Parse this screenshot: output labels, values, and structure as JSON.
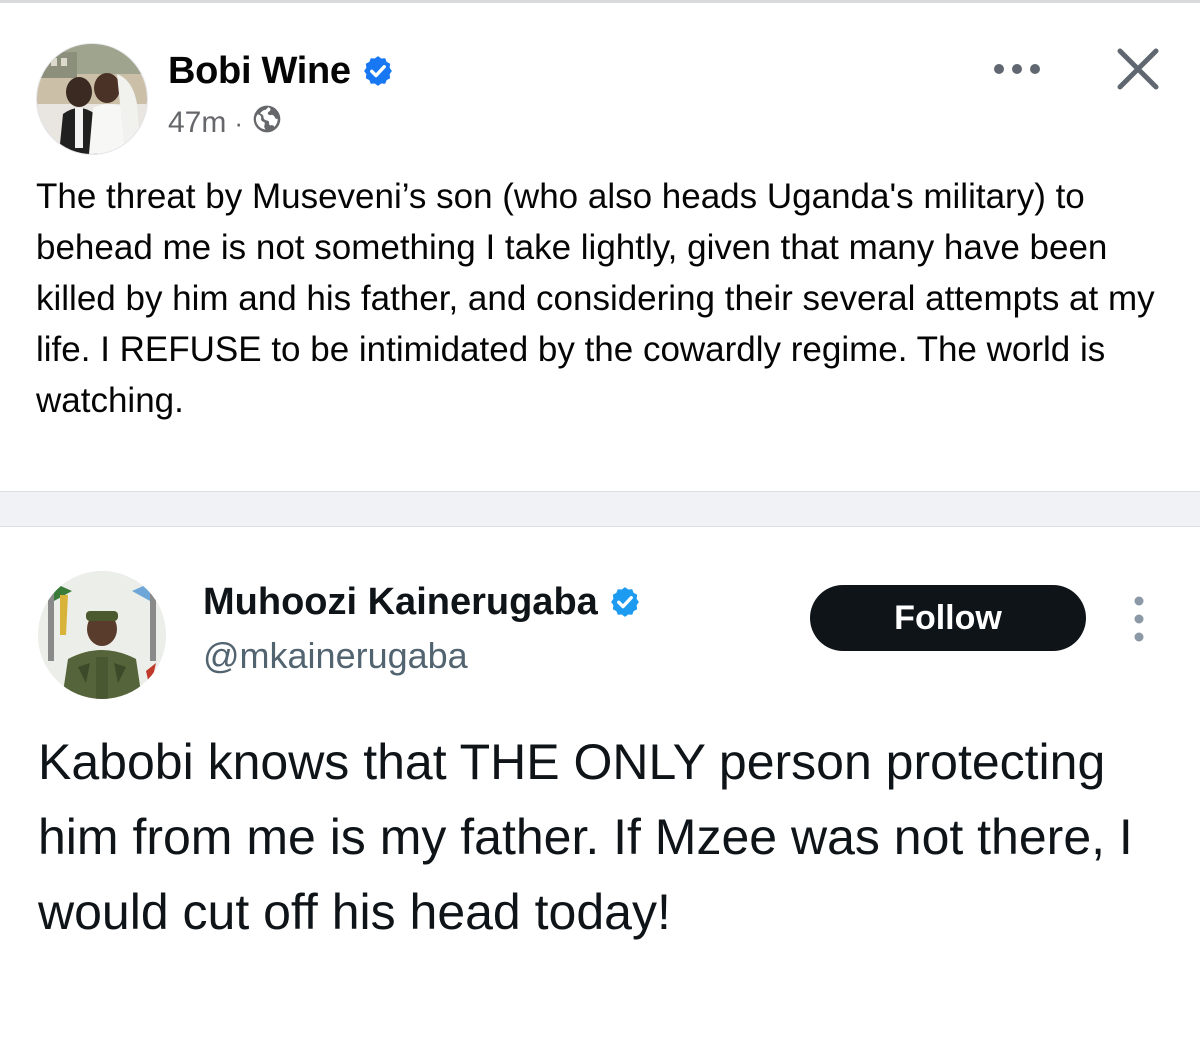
{
  "facebook_post": {
    "author_name": "Bobi Wine",
    "timestamp": "47m",
    "meta_separator": "·",
    "body": "The threat by Museveni’s son (who also heads Uganda's military) to behead me is not something I take lightly, given that many have been killed by him and his father, and considering their several attempts at my life. I REFUSE to be intimidated by the cowardly regime. The world is watching.",
    "icons": {
      "verified": "verified-badge-icon",
      "audience": "globe-icon",
      "more": "more-options-icon",
      "close": "close-icon"
    },
    "accent_color": "#1877f2"
  },
  "tweet": {
    "author_name": "Muhoozi Kainerugaba",
    "handle": "@mkainerugaba",
    "follow_label": "Follow",
    "body": "Kabobi knows that THE ONLY person protecting him from me is my father. If Mzee was not there, I would cut off his head today!",
    "icons": {
      "verified": "verified-badge-icon",
      "more": "vertical-more-icon"
    },
    "accent_color": "#1d9bf0"
  }
}
